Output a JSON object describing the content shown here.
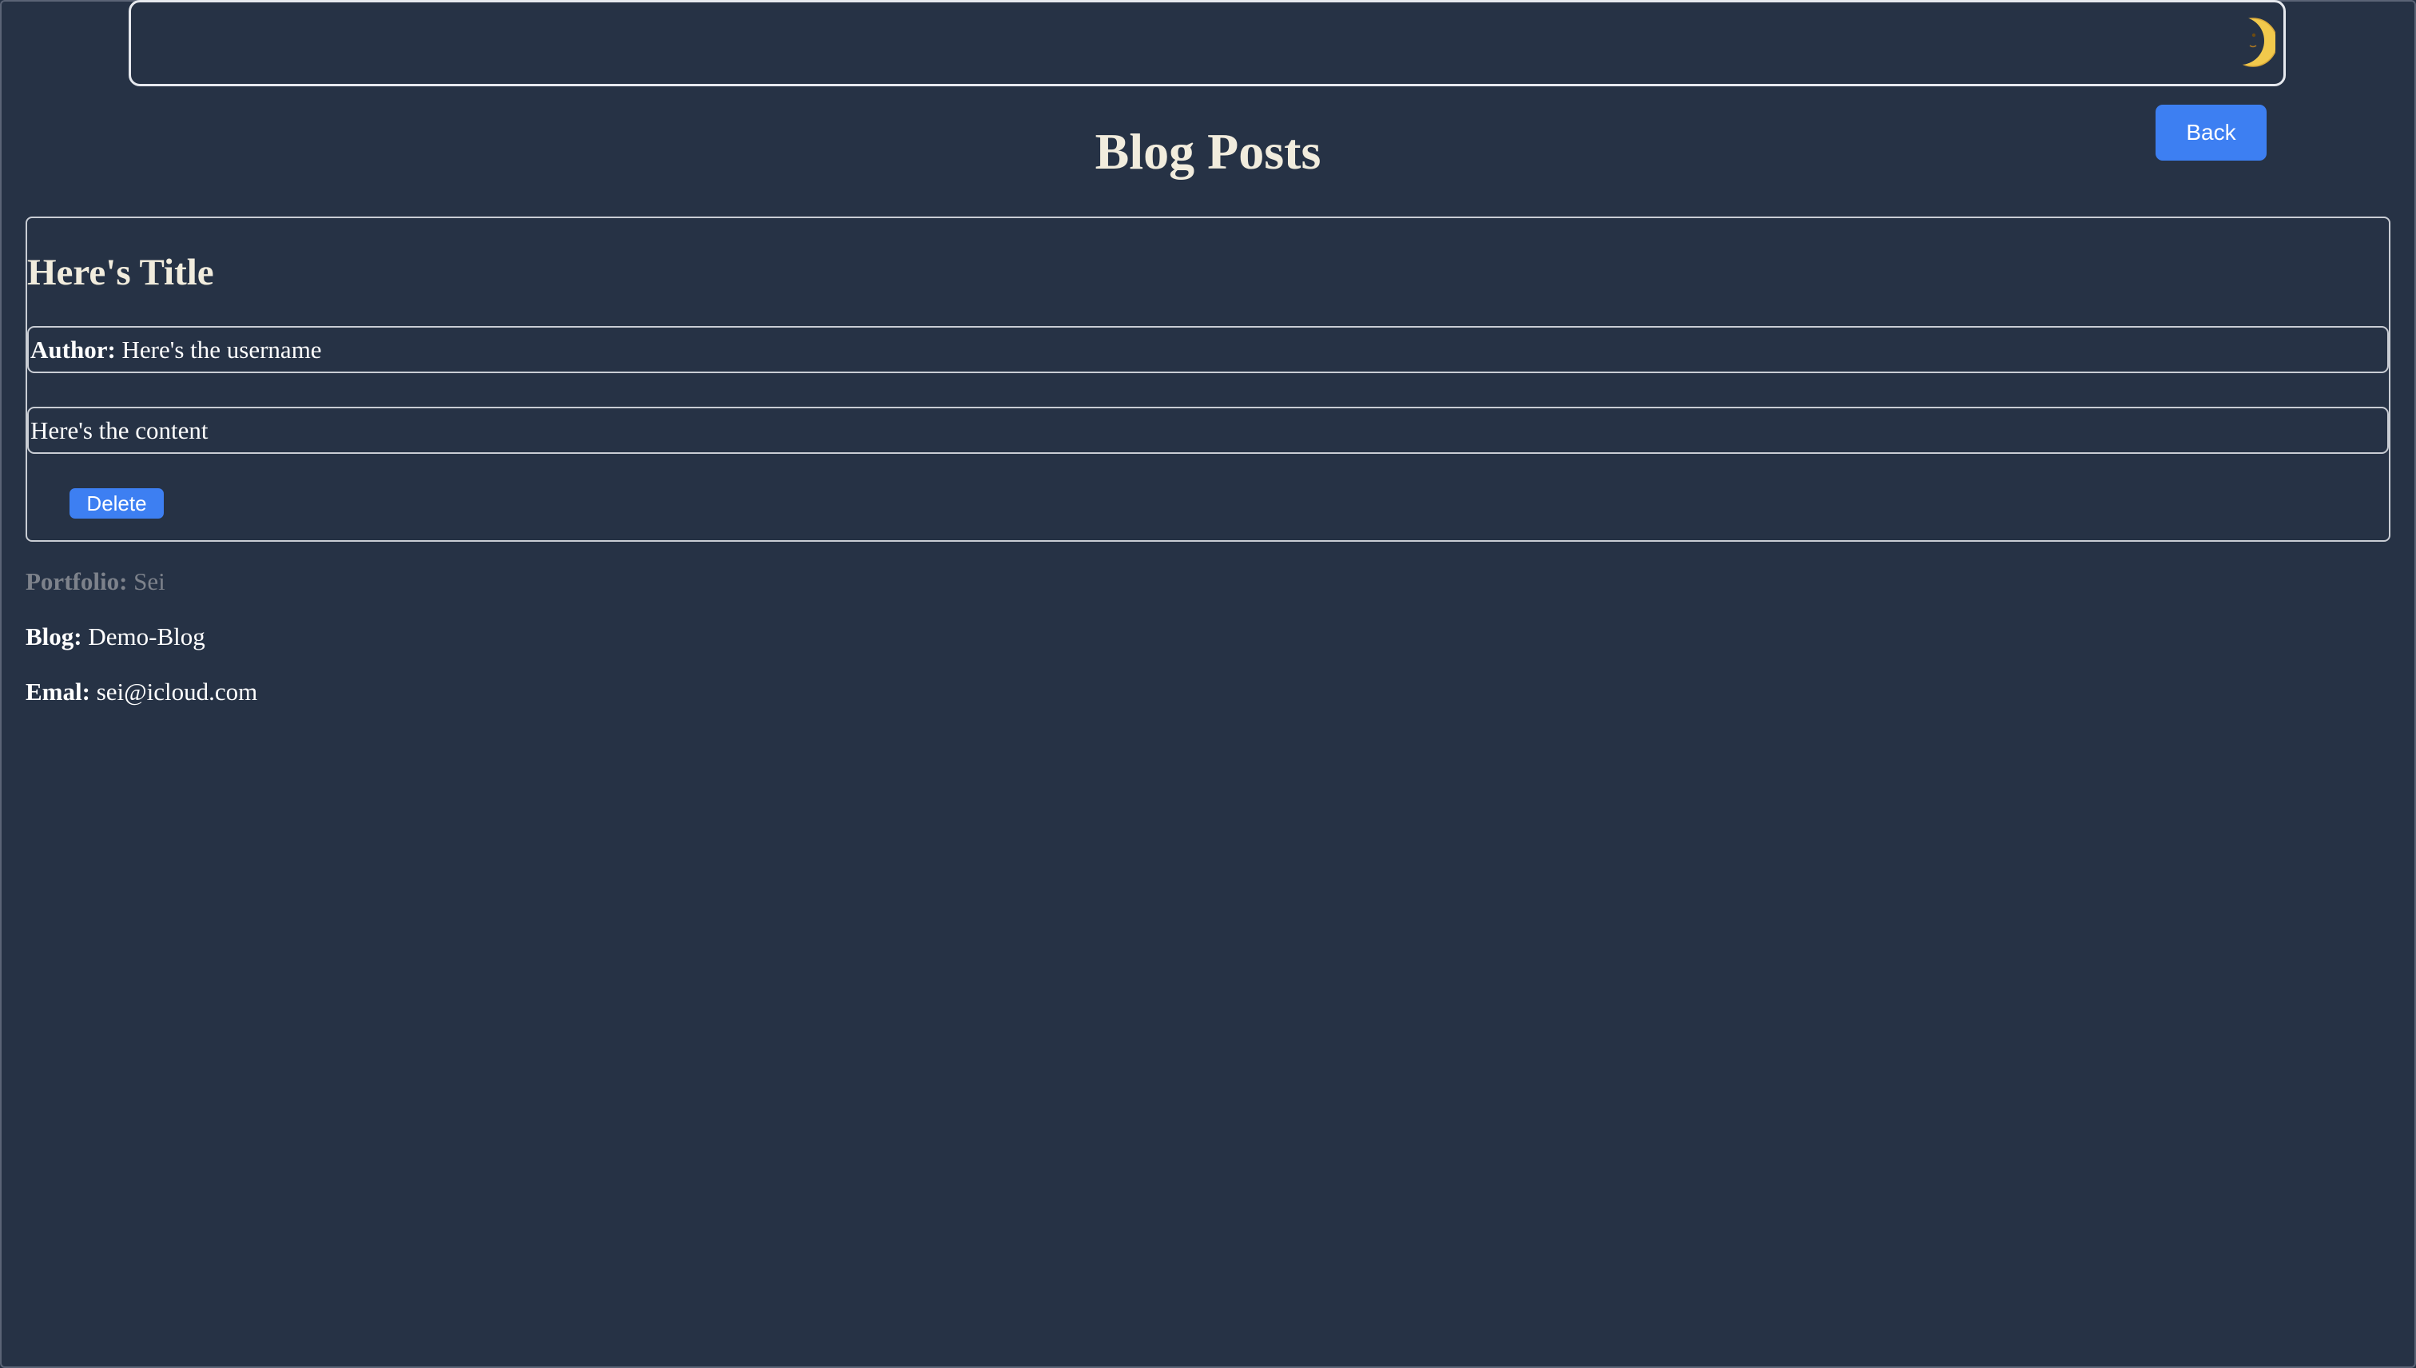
{
  "header": {
    "theme_toggle_icon": "crescent-moon-icon"
  },
  "nav": {
    "back_label": "Back"
  },
  "page": {
    "title": "Blog Posts"
  },
  "post": {
    "title": "Here's Title",
    "author_label": "Author:",
    "author_value": "Here's the username",
    "content": "Here's the content",
    "delete_label": "Delete"
  },
  "footer": {
    "portfolio_label": "Portfolio:",
    "portfolio_value": "Sei",
    "blog_label": "Blog:",
    "blog_value": "Demo-Blog",
    "email_label": "Emal:",
    "email_value": "sei@icloud.com"
  },
  "colors": {
    "background": "#263245",
    "accent": "#3d7ff2",
    "title_text": "#f1ecdd",
    "muted_text": "#7d828b",
    "border": "#c9cdd4"
  }
}
